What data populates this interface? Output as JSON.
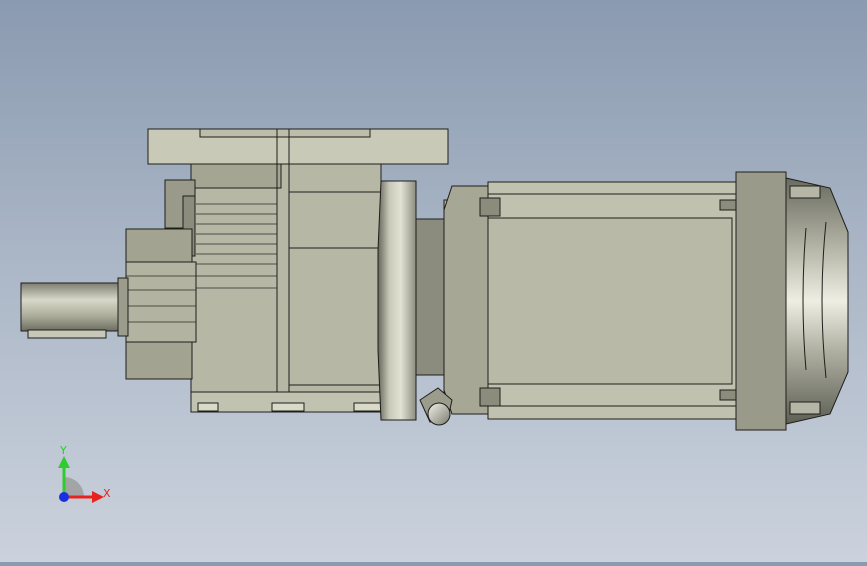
{
  "viewport": {
    "model": "gear-motor",
    "view": "front",
    "background": [
      "#8a9ab0",
      "#cbd2dd"
    ]
  },
  "triad": {
    "x_label": "X",
    "y_label": "Y",
    "x_color": "#e8231e",
    "y_color": "#2ecc2e",
    "z_color": "#1b2ee0"
  }
}
